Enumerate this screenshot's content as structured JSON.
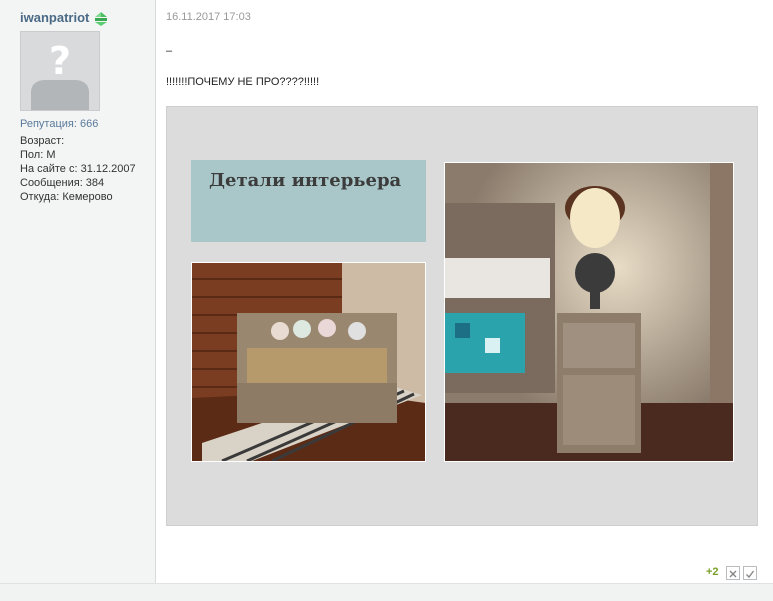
{
  "user": {
    "name": "iwanpatriot",
    "reputation": "Репутация: 666",
    "age": "Возраст:",
    "gender": "Пол: М",
    "since": "На сайте с: 31.12.2007",
    "messages": "Сообщения: 384",
    "location": "Откуда: Кемерово"
  },
  "post": {
    "date": "16.11.2017 17:03",
    "dash": "–",
    "text": "!!!!!!!ПОЧЕМУ НЕ ПРО????!!!!!",
    "image": {
      "banner_title": "Детали интерьера"
    }
  },
  "votes": {
    "count": "+2"
  },
  "colors": {
    "username": "#4a6a86",
    "vote_count": "#7aa02a",
    "banner": "#a9c7c8"
  }
}
